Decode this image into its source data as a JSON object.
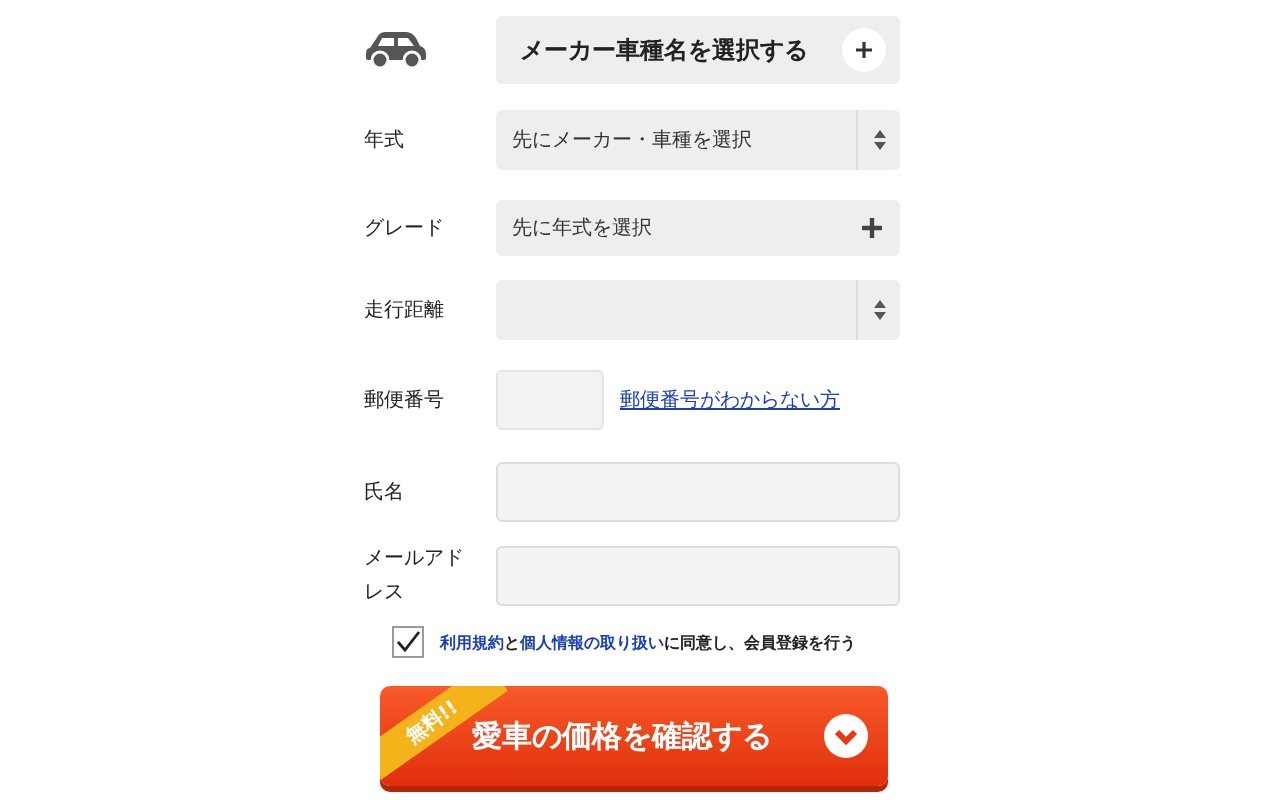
{
  "maker_button": {
    "label": "メーカー車種名を選択する"
  },
  "fields": [
    {
      "label": "年式",
      "kind": "select",
      "value": "先にメーカー・車種を選択"
    },
    {
      "label": "グレード",
      "kind": "picker",
      "value": "先に年式を選択"
    },
    {
      "label": "走行距離",
      "kind": "select"
    },
    {
      "label": "郵便番号",
      "kind": "zip",
      "link": "郵便番号がわからない方"
    },
    {
      "label": "氏名",
      "kind": "text"
    },
    {
      "label": "メールアドレス",
      "kind": "text"
    }
  ],
  "agreement": {
    "checked": true,
    "parts": [
      {
        "kind": "link",
        "text": "利用規約"
      },
      {
        "kind": "text",
        "text": "と"
      },
      {
        "kind": "link",
        "text": "個人情報の取り扱い"
      },
      {
        "kind": "text",
        "text": "に同意し、会員登録を行う"
      }
    ]
  },
  "submit": {
    "label": "愛車の価格を確認する",
    "badge": "無料!!"
  }
}
